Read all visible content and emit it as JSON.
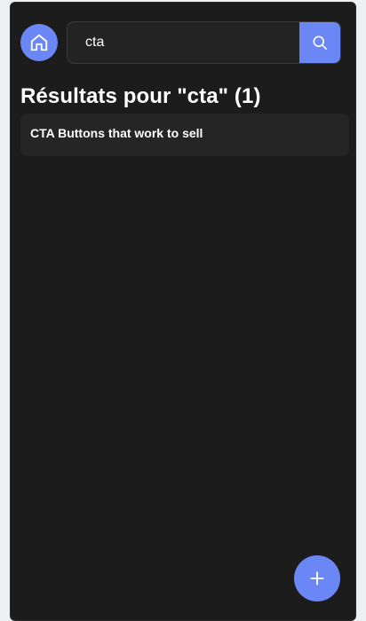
{
  "search": {
    "value": "cta",
    "placeholder": ""
  },
  "results": {
    "title": "Résultats pour \"cta\" (1)",
    "items": [
      {
        "title": "CTA Buttons that work to sell"
      }
    ]
  },
  "icons": {
    "home": "home-icon",
    "search": "search-icon",
    "add": "plus-icon"
  },
  "colors": {
    "accent": "#6b86f5",
    "background": "#1c1c1c",
    "card": "#252525",
    "page": "#eef0f3"
  }
}
